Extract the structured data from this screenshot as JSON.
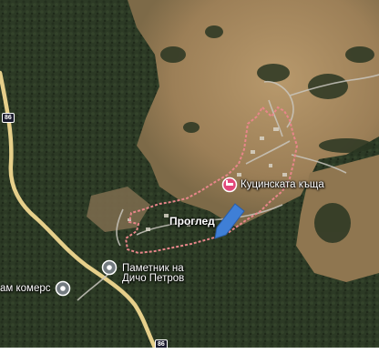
{
  "labels": {
    "kutsinska": "Куцинската къща",
    "progled": "Проглед",
    "pametnik_line1": "Паметник на",
    "pametnik_line2": "Дичо Петров",
    "komers": "ам комерс"
  },
  "road_shields": {
    "top": "86",
    "bottom": "86"
  },
  "colors": {
    "forest": "#2c3a25",
    "meadow": "#a88c63",
    "road": "#e6cf8a",
    "boundary": "#e8868a",
    "marker_blue": "#3f7fd6",
    "hotel_pin": "#e2487a"
  },
  "icons": {
    "hotel_pin": "hotel-icon",
    "poi_pin": "location-pin-icon",
    "arrow": "direction-arrow-icon"
  }
}
